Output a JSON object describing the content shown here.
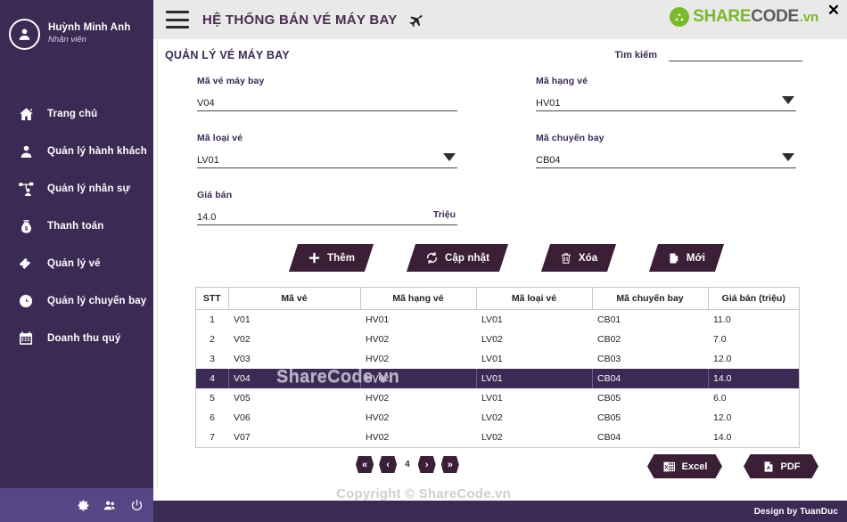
{
  "window": {
    "close_label": "✕"
  },
  "brand": {
    "share": "SHARE",
    "code": "CODE",
    "vn": ".vn",
    "mark_color": "#7ab929",
    "share_color": "#7ab929",
    "code_color": "#5c5c5c"
  },
  "header": {
    "title": "HỆ THỐNG BÁN VÉ MÁY BAY",
    "menu_icon": "hamburger-icon",
    "plane_icon": "airplane-icon",
    "background": "#e9e9e9",
    "title_color": "#4a2c4e"
  },
  "sidebar": {
    "background": "#3b2a54",
    "footer_background": "#564685",
    "user": {
      "name": "Huỳnh Minh Anh",
      "role": "Nhân viên",
      "avatar_icon": "user-avatar-icon"
    },
    "items": [
      {
        "label": "Trang chủ",
        "icon": "home-icon"
      },
      {
        "label": "Quản lý hành khách",
        "icon": "person-icon"
      },
      {
        "label": "Quản lý nhân sự",
        "icon": "org-chart-icon"
      },
      {
        "label": "Thanh toán",
        "icon": "money-bag-icon"
      },
      {
        "label": "Quản lý vé",
        "icon": "ticket-icon"
      },
      {
        "label": "Quản lý chuyến bay",
        "icon": "clock-icon"
      },
      {
        "label": "Doanh thu quý",
        "icon": "calendar-icon"
      }
    ],
    "footer_icons": [
      {
        "name": "gear-icon"
      },
      {
        "name": "users-icon"
      },
      {
        "name": "power-icon"
      }
    ]
  },
  "main": {
    "page_title": "QUẢN LÝ VÉ MÁY BAY",
    "search": {
      "label": "Tìm kiếm",
      "value": "",
      "placeholder": ""
    },
    "form": {
      "ma_ve_may_bay": {
        "label": "Mã vé máy bay",
        "value": "V04",
        "type": "text"
      },
      "ma_hang_ve": {
        "label": "Mã hạng vé",
        "value": "HV01",
        "type": "select"
      },
      "ma_loai_ve": {
        "label": "Mã loại vé",
        "value": "LV01",
        "type": "select"
      },
      "ma_chuyen_bay": {
        "label": "Mã chuyến bay",
        "value": "CB04",
        "type": "select"
      },
      "gia_ban": {
        "label": "Giá bán",
        "value": "14.0",
        "unit": "Triệu",
        "type": "text"
      }
    },
    "actions": [
      {
        "label": "Thêm",
        "icon": "plus-icon"
      },
      {
        "label": "Cập nhật",
        "icon": "refresh-icon"
      },
      {
        "label": "Xóa",
        "icon": "trash-icon"
      },
      {
        "label": "Mới",
        "icon": "new-file-icon"
      }
    ],
    "table": {
      "columns": [
        "STT",
        "Mã vé",
        "Mã hạng vé",
        "Mã loại vé",
        "Mã chuyến bay",
        "Giá bán (triệu)"
      ],
      "rows": [
        {
          "stt": "1",
          "ma_ve": "V01",
          "ma_hang_ve": "HV01",
          "ma_loai_ve": "LV01",
          "ma_chuyen_bay": "CB01",
          "gia_ban": "11.0",
          "selected": false
        },
        {
          "stt": "2",
          "ma_ve": "V02",
          "ma_hang_ve": "HV02",
          "ma_loai_ve": "LV02",
          "ma_chuyen_bay": "CB02",
          "gia_ban": "7.0",
          "selected": false
        },
        {
          "stt": "3",
          "ma_ve": "V03",
          "ma_hang_ve": "HV02",
          "ma_loai_ve": "LV01",
          "ma_chuyen_bay": "CB03",
          "gia_ban": "12.0",
          "selected": false
        },
        {
          "stt": "4",
          "ma_ve": "V04",
          "ma_hang_ve": "HV02",
          "ma_loai_ve": "LV01",
          "ma_chuyen_bay": "CB04",
          "gia_ban": "14.0",
          "selected": true
        },
        {
          "stt": "5",
          "ma_ve": "V05",
          "ma_hang_ve": "HV02",
          "ma_loai_ve": "LV01",
          "ma_chuyen_bay": "CB05",
          "gia_ban": "6.0",
          "selected": false
        },
        {
          "stt": "6",
          "ma_ve": "V06",
          "ma_hang_ve": "HV02",
          "ma_loai_ve": "LV02",
          "ma_chuyen_bay": "CB05",
          "gia_ban": "12.0",
          "selected": false
        },
        {
          "stt": "7",
          "ma_ve": "V07",
          "ma_hang_ve": "HV02",
          "ma_loai_ve": "LV02",
          "ma_chuyen_bay": "CB04",
          "gia_ban": "14.0",
          "selected": false
        }
      ],
      "watermark": "ShareCode.vn",
      "selected_row_color": "#3b2a54"
    },
    "pager": {
      "first": "«",
      "prev": "‹",
      "page": "4",
      "next": "›",
      "last": "»"
    },
    "exports": [
      {
        "label": "Excel",
        "icon": "excel-icon"
      },
      {
        "label": "PDF",
        "icon": "pdf-icon"
      }
    ]
  },
  "footer": {
    "copyright": "Copyright © ShareCode.vn",
    "design_by": "Design by TuanDuc"
  }
}
